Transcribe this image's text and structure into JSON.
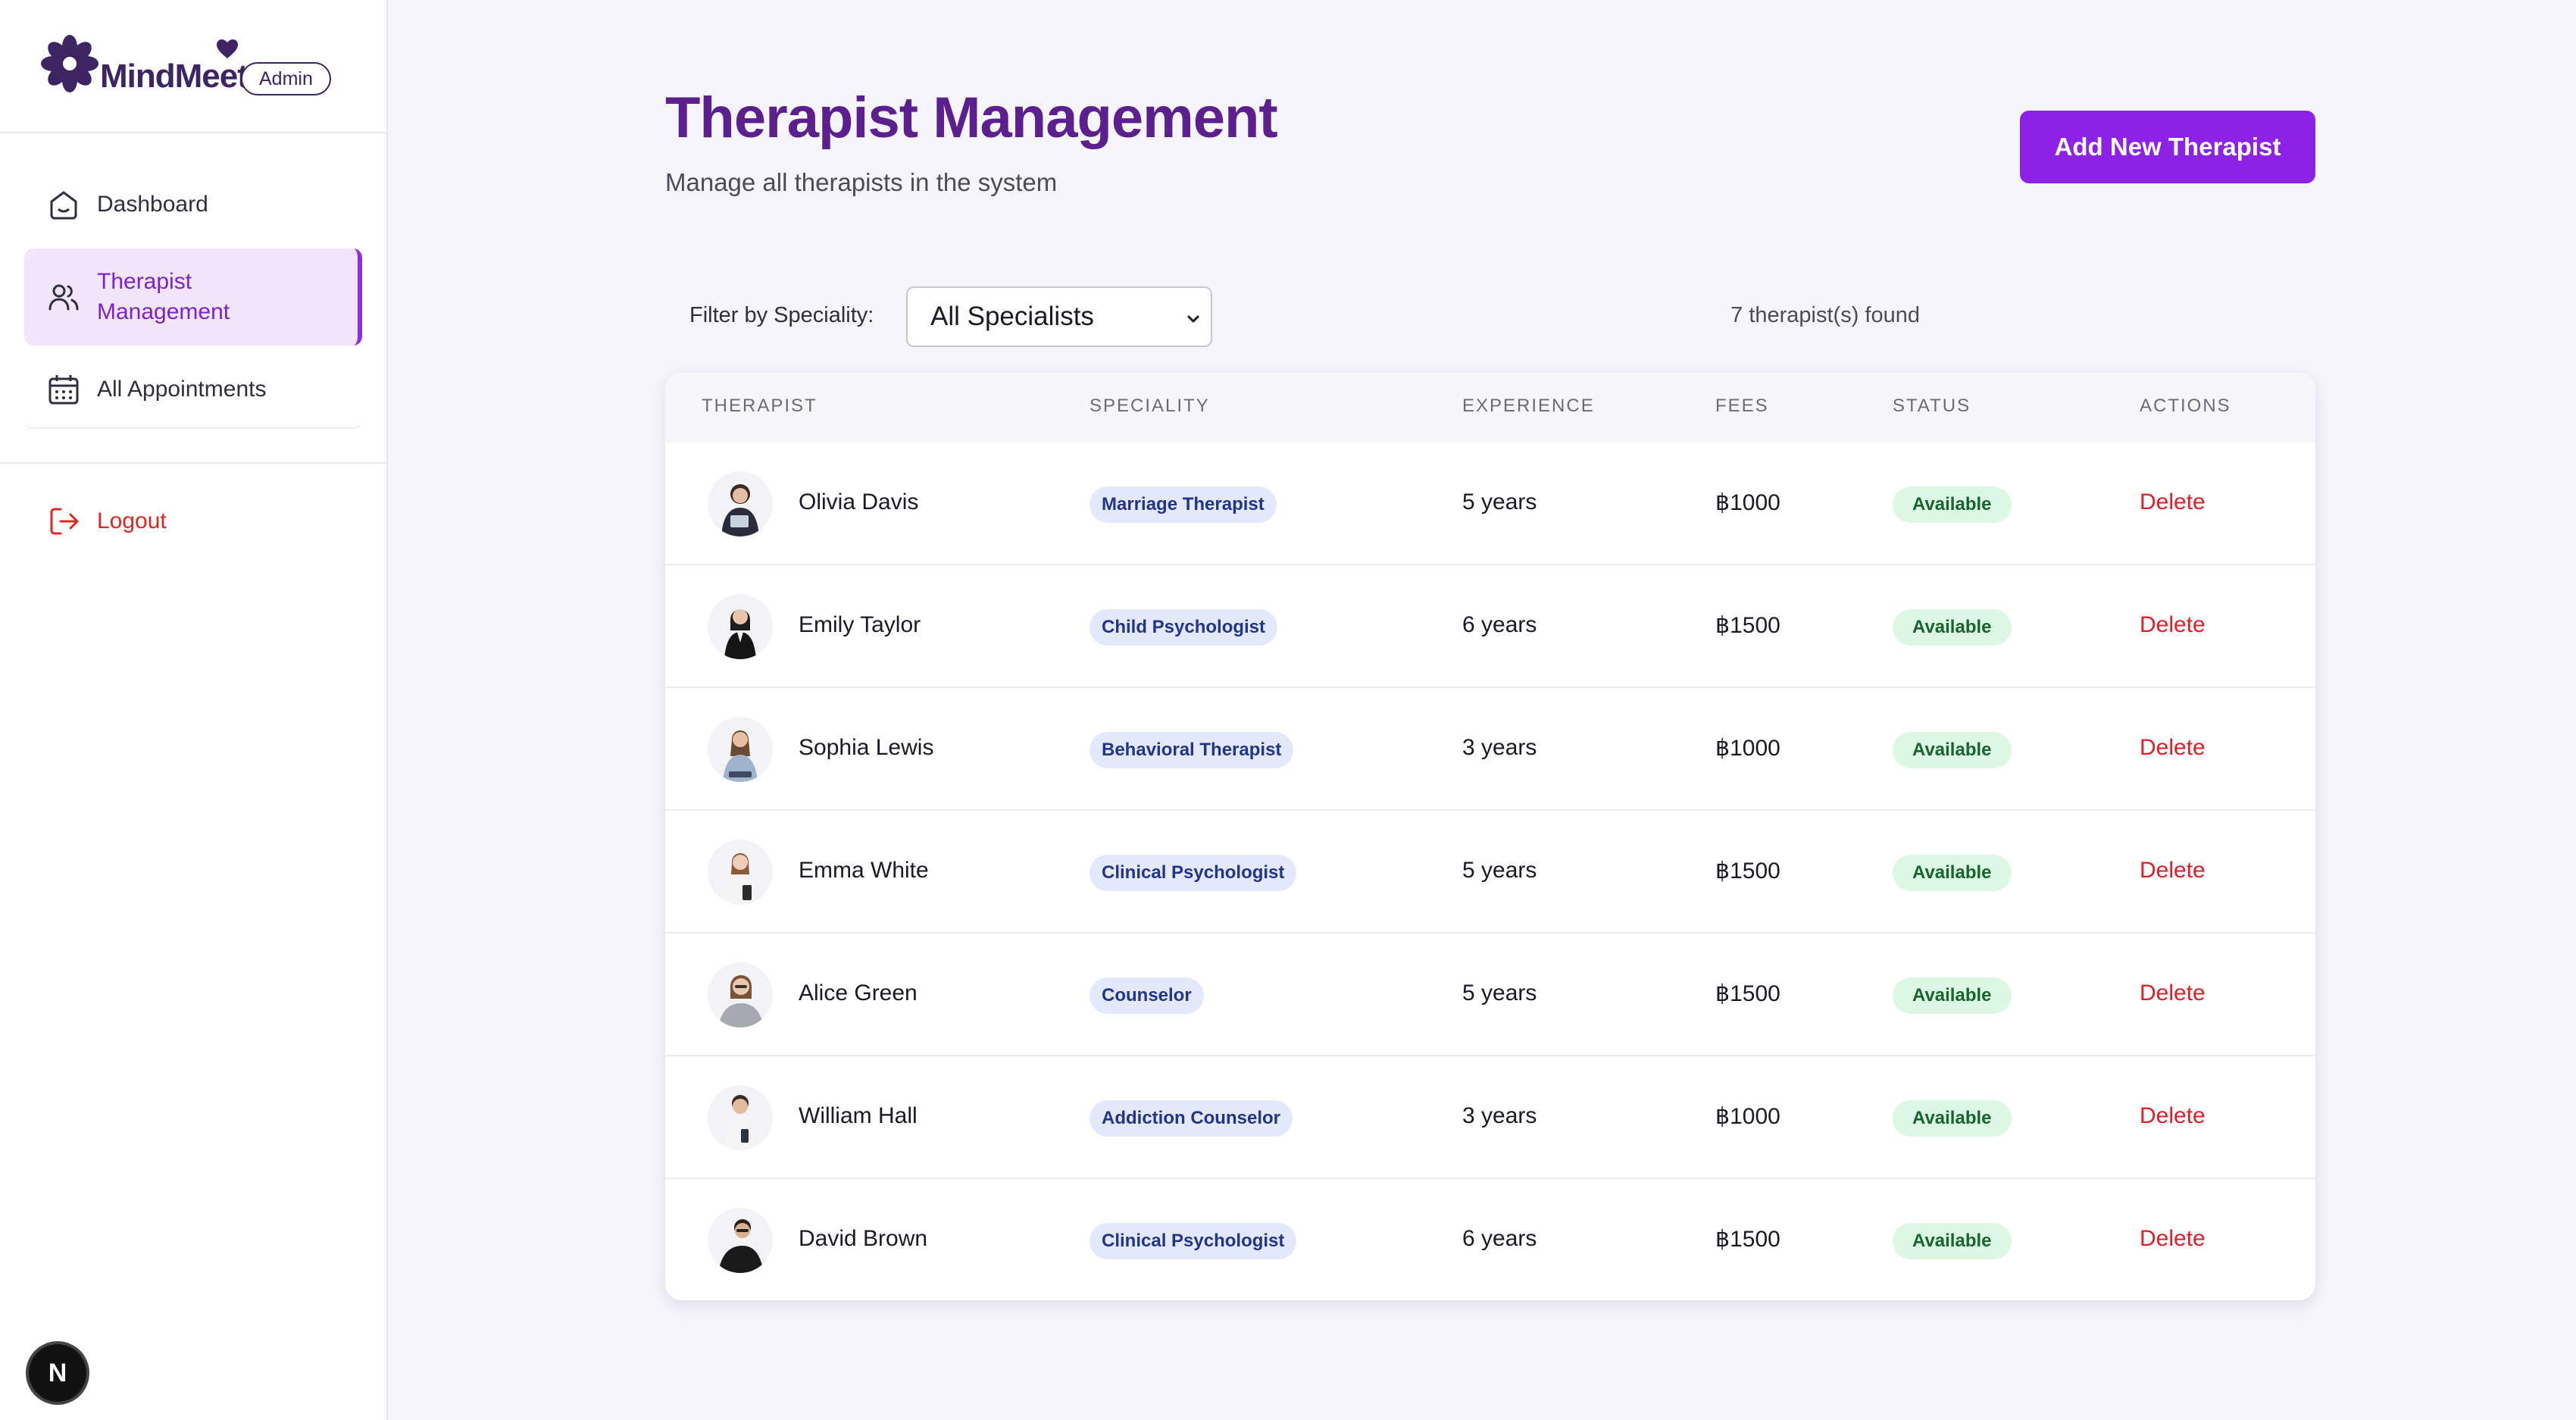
{
  "brand": {
    "name": "MindMeet",
    "badge": "Admin",
    "color": "#3d2463"
  },
  "sidebar": {
    "items": [
      {
        "label": "Dashboard",
        "icon": "home-icon"
      },
      {
        "label": "Therapist Management",
        "icon": "users-icon",
        "active": true
      },
      {
        "label": "All Appointments",
        "icon": "calendar-icon"
      }
    ],
    "logout": {
      "label": "Logout",
      "icon": "logout-icon"
    },
    "framework_badge": "N"
  },
  "header": {
    "title": "Therapist Management",
    "subtitle": "Manage all therapists in the system",
    "add_button": "Add New Therapist"
  },
  "filter": {
    "label": "Filter by Speciality:",
    "selected": "All Specialists",
    "count_text": "7 therapist(s) found"
  },
  "table": {
    "columns": [
      "THERAPIST",
      "SPECIALITY",
      "EXPERIENCE",
      "FEES",
      "STATUS",
      "ACTIONS"
    ],
    "rows": [
      {
        "name": "Olivia Davis",
        "speciality": "Marriage Therapist",
        "experience": "5 years",
        "fees": "฿1000",
        "status": "Available",
        "action": "Delete"
      },
      {
        "name": "Emily Taylor",
        "speciality": "Child Psychologist",
        "experience": "6 years",
        "fees": "฿1500",
        "status": "Available",
        "action": "Delete"
      },
      {
        "name": "Sophia Lewis",
        "speciality": "Behavioral Therapist",
        "experience": "3 years",
        "fees": "฿1000",
        "status": "Available",
        "action": "Delete"
      },
      {
        "name": "Emma White",
        "speciality": "Clinical Psychologist",
        "experience": "5 years",
        "fees": "฿1500",
        "status": "Available",
        "action": "Delete"
      },
      {
        "name": "Alice Green",
        "speciality": "Counselor",
        "experience": "5 years",
        "fees": "฿1500",
        "status": "Available",
        "action": "Delete"
      },
      {
        "name": "William Hall",
        "speciality": "Addiction Counselor",
        "experience": "3 years",
        "fees": "฿1000",
        "status": "Available",
        "action": "Delete"
      },
      {
        "name": "David Brown",
        "speciality": "Clinical Psychologist",
        "experience": "6 years",
        "fees": "฿1500",
        "status": "Available",
        "action": "Delete"
      }
    ]
  },
  "colors": {
    "accent": "#8b22e6",
    "title": "#5b1f8e",
    "danger": "#dc1f2a",
    "status_bg": "#dcf7e4",
    "spec_bg": "#e3e9fb"
  }
}
